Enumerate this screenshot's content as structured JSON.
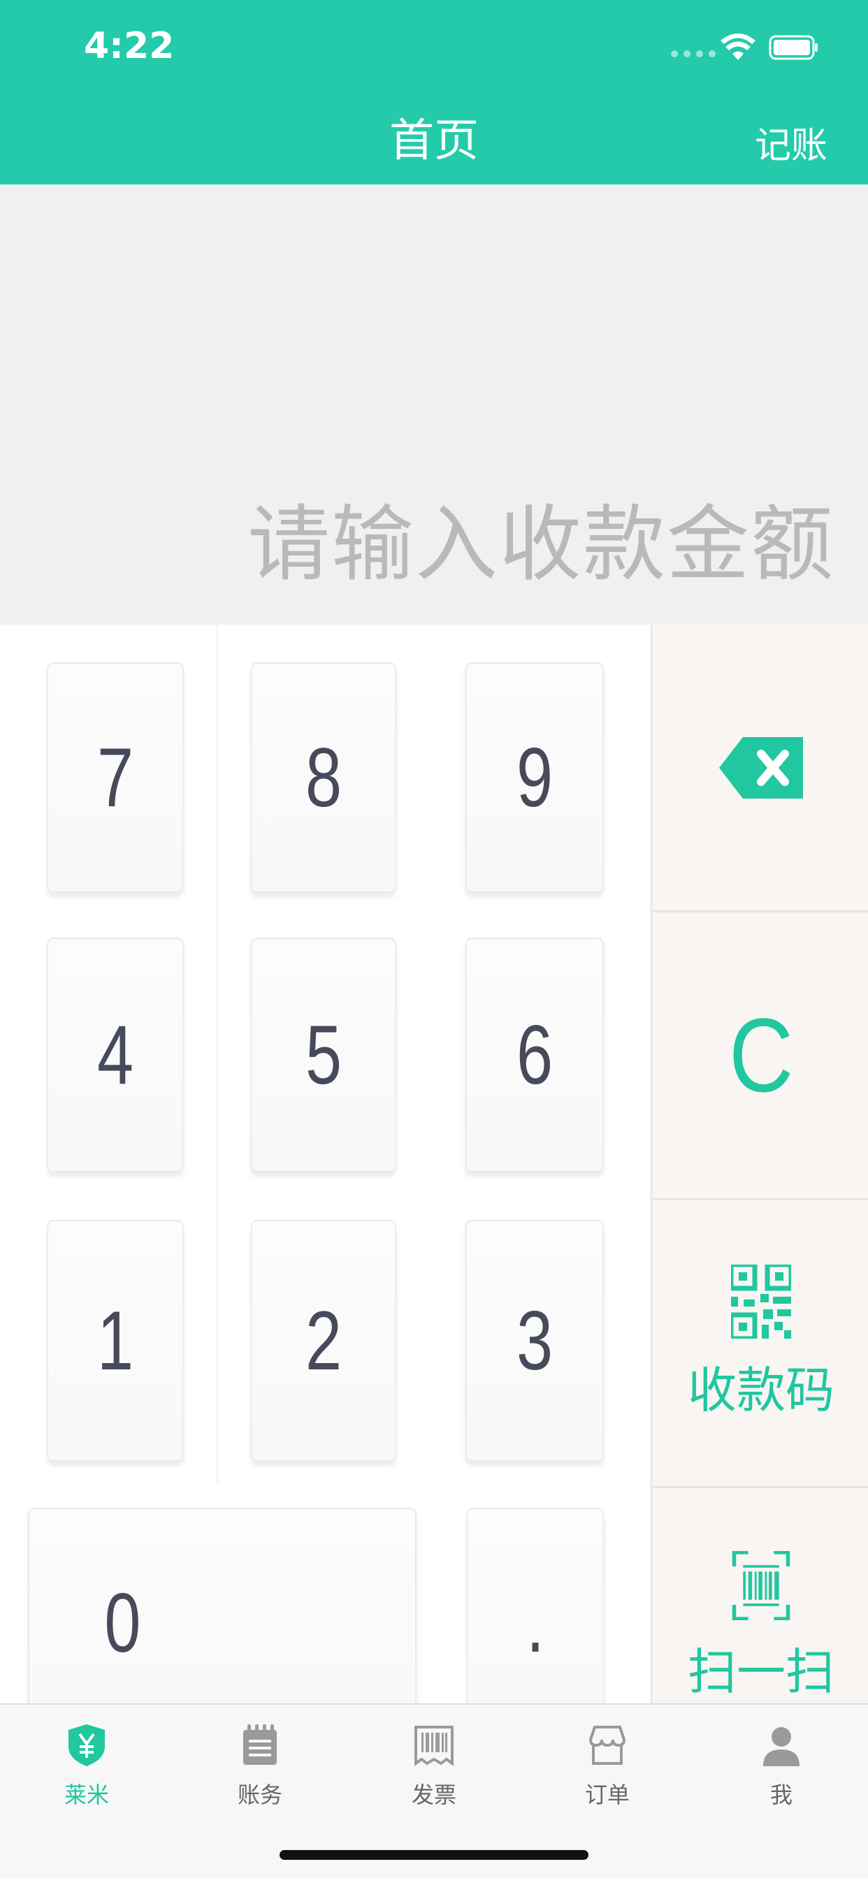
{
  "status": {
    "time": "4:22"
  },
  "nav": {
    "title": "首页",
    "right_action": "记账"
  },
  "amount": {
    "placeholder": "请输入收款金额"
  },
  "keypad": {
    "keys": [
      "7",
      "8",
      "9",
      "4",
      "5",
      "6",
      "1",
      "2",
      "3",
      "0",
      "."
    ]
  },
  "side": {
    "clear": "C",
    "collect_code": "收款码",
    "scan": "扫一扫"
  },
  "tabs": [
    {
      "label": "莱米",
      "icon": "shield-yen-icon",
      "active": true
    },
    {
      "label": "账务",
      "icon": "notebook-icon"
    },
    {
      "label": "发票",
      "icon": "invoice-icon"
    },
    {
      "label": "订单",
      "icon": "store-icon"
    },
    {
      "label": "我",
      "icon": "person-icon"
    }
  ],
  "colors": {
    "accent": "#23cbaa",
    "key_text": "#464a5a",
    "placeholder": "#b9b9b9"
  }
}
